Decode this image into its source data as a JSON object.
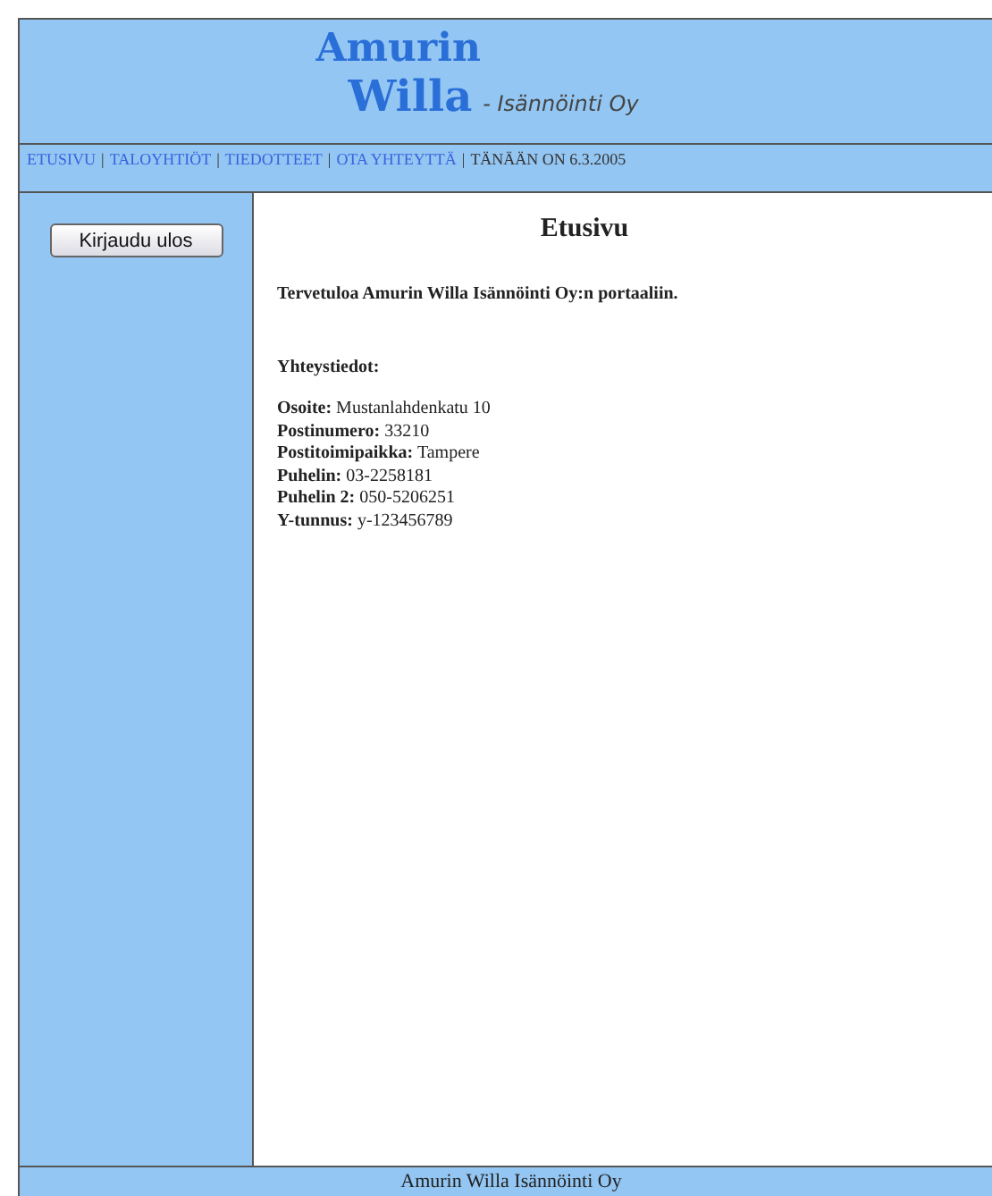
{
  "logo": {
    "line_1": "Amurin",
    "line_2": "Willa",
    "tagline": "- Isännöinti Oy"
  },
  "nav": {
    "links": [
      "ETUSIVU",
      "TALOYHTIÖT",
      "TIEDOTTEET",
      "OTA YHTEYTTÄ"
    ],
    "separator": "|",
    "date_text": "TÄNÄÄN ON 6.3.2005"
  },
  "sidebar": {
    "button": "Kirjaudu ulos"
  },
  "content": {
    "title": "Etusivu",
    "welcome": "Tervetuloa Amurin Willa Isännöinti Oy:n portaaliin.",
    "contact_heading": "Yhteystiedot:",
    "contact": [
      {
        "label": "Osoite:",
        "value": "Mustanlahdenkatu 10"
      },
      {
        "label": "Postinumero:",
        "value": "33210"
      },
      {
        "label": "Postitoimipaikka:",
        "value": "Tampere"
      },
      {
        "label": "Puhelin:",
        "value": "03-2258181"
      },
      {
        "label": "Puhelin 2:",
        "value": "050-5206251"
      },
      {
        "label": "Y-tunnus:",
        "value": "y-123456789"
      }
    ]
  },
  "footer": "Amurin Willa Isännöinti Oy"
}
